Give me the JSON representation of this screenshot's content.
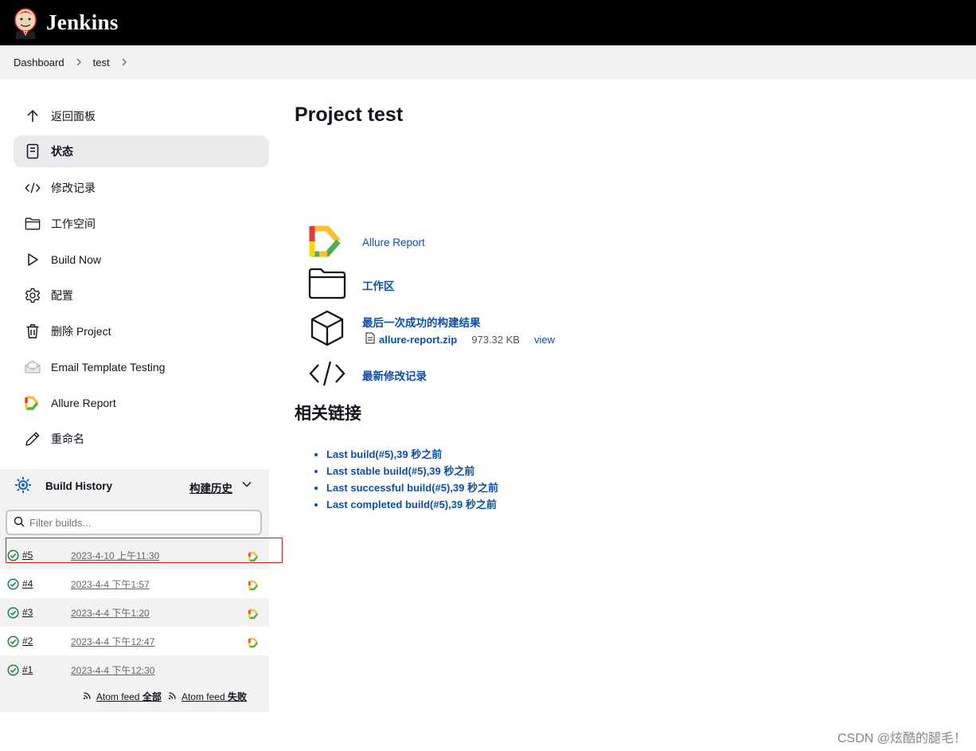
{
  "header": {
    "brand": "Jenkins"
  },
  "breadcrumbs": [
    "Dashboard",
    "test"
  ],
  "sidebar": {
    "items": [
      {
        "label": "返回面板",
        "icon": "arrow-up-icon"
      },
      {
        "label": "状态",
        "icon": "document-icon",
        "active": true
      },
      {
        "label": "修改记录",
        "icon": "code-icon"
      },
      {
        "label": "工作空间",
        "icon": "folder-icon"
      },
      {
        "label": "Build Now",
        "icon": "play-icon"
      },
      {
        "label": "配置",
        "icon": "gear-icon"
      },
      {
        "label": "删除 Project",
        "icon": "trash-icon"
      },
      {
        "label": "Email Template Testing",
        "icon": "envelope-icon"
      },
      {
        "label": "Allure Report",
        "icon": "allure-icon"
      },
      {
        "label": "重命名",
        "icon": "pencil-icon"
      }
    ]
  },
  "build_history": {
    "title": "Build History",
    "trend": "构建历史",
    "filter_placeholder": "Filter builds...",
    "builds": [
      {
        "number": "#5",
        "date": "2023-4-10 上午11:30"
      },
      {
        "number": "#4",
        "date": "2023-4-4 下午1:57"
      },
      {
        "number": "#3",
        "date": "2023-4-4 下午1:20"
      },
      {
        "number": "#2",
        "date": "2023-4-4 下午12:47"
      },
      {
        "number": "#1",
        "date": "2023-4-4 下午12:30"
      }
    ],
    "feeds": {
      "all_prefix": "Atom feed",
      "all": "全部",
      "failed_prefix": "Atom feed",
      "failed": "失败"
    }
  },
  "main": {
    "title": "Project test",
    "links": {
      "allure": "Allure Report",
      "workspace": "工作区",
      "last_success": "最后一次成功的构建结果",
      "recent_changes": "最新修改记录"
    },
    "artifact": {
      "name": "allure-report.zip",
      "size": "973.32 KB",
      "view": "view"
    },
    "related_title": "相关链接",
    "permalinks": [
      "Last build(#5),39 秒之前",
      "Last stable build(#5),39 秒之前",
      "Last successful build(#5),39 秒之前",
      "Last completed build(#5),39 秒之前"
    ]
  },
  "watermark": "CSDN @炫酷的腿毛！",
  "colors": {
    "header": "#000000",
    "link": "#0b4fa8",
    "success": "#138347",
    "highlight": "#e0161f"
  }
}
